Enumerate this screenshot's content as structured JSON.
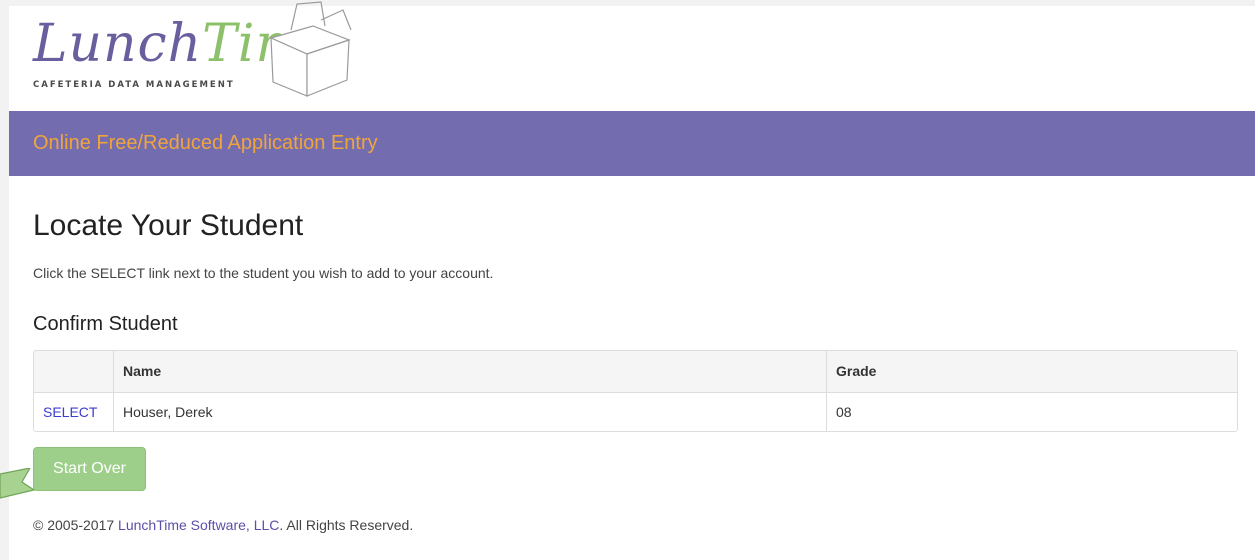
{
  "header": {
    "logo_word_a": "Lunch",
    "logo_word_b": "Time",
    "logo_tagline": "CAFETERIA DATA MANAGEMENT"
  },
  "banner": {
    "title": "Online Free/Reduced Application Entry"
  },
  "main": {
    "page_title": "Locate Your Student",
    "instructions": "Click the SELECT link next to the student you wish to add to your account.",
    "section_title": "Confirm Student",
    "table": {
      "columns": [
        "",
        "Name",
        "Grade"
      ],
      "rows": [
        {
          "action": "SELECT",
          "name": "Houser, Derek",
          "grade": "08"
        }
      ]
    },
    "start_over_label": "Start Over"
  },
  "footer": {
    "prefix": "© 2005-2017 ",
    "link": "LunchTime Software, LLC",
    "suffix": ". All Rights Reserved."
  },
  "colors": {
    "banner_bg": "#736db0",
    "banner_text": "#f0a43c",
    "button_bg": "#9dcf8a",
    "link": "#3b3bd6"
  },
  "icons": {
    "logo_box": "lunch-box-icon",
    "cursor_flag": "flag-marker-icon"
  }
}
